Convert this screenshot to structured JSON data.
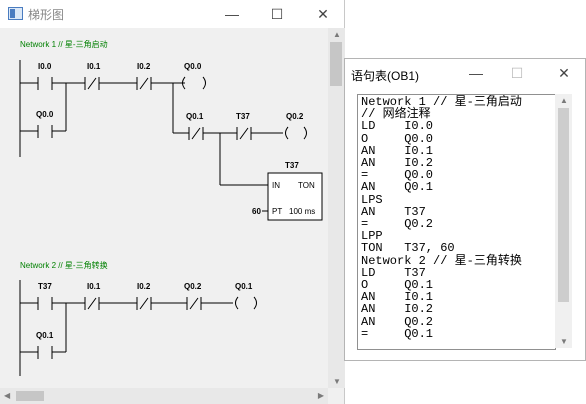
{
  "ladder_window": {
    "title": "梯形图",
    "controls": {
      "minimize": "—",
      "maximize": "☐",
      "close": "✕"
    },
    "network1": {
      "title": "Network 1 // 星-三角启动",
      "contacts": [
        "I0.0",
        "I0.1",
        "I0.2",
        "Q0.0",
        "Q0.1",
        "T37"
      ],
      "coils": [
        "Q0.0",
        "Q0.2"
      ],
      "timer": {
        "name": "T37",
        "in": "IN",
        "type": "TON",
        "preset_label": "PT",
        "preset_value": "60",
        "unit": "100 ms"
      }
    },
    "network2": {
      "title": "Network 2 // 星-三角转换",
      "contacts": [
        "T37",
        "I0.1",
        "I0.2",
        "Q0.2",
        "Q0.1"
      ],
      "coils": [
        "Q0.1"
      ]
    }
  },
  "stl_window": {
    "title": "语句表(OB1)",
    "controls": {
      "minimize": "—",
      "maximize": "☐",
      "close": "✕"
    },
    "lines": [
      "Network 1 // 星-三角启动",
      "// 网络注释",
      "LD    I0.0",
      "O     Q0.0",
      "AN    I0.1",
      "AN    I0.2",
      "=     Q0.0",
      "AN    Q0.1",
      "LPS",
      "AN    T37",
      "=     Q0.2",
      "LPP",
      "TON   T37, 60",
      "Network 2 // 星-三角转换",
      "LD    T37",
      "O     Q0.1",
      "AN    I0.1",
      "AN    I0.2",
      "AN    Q0.2",
      "=     Q0.1"
    ]
  }
}
